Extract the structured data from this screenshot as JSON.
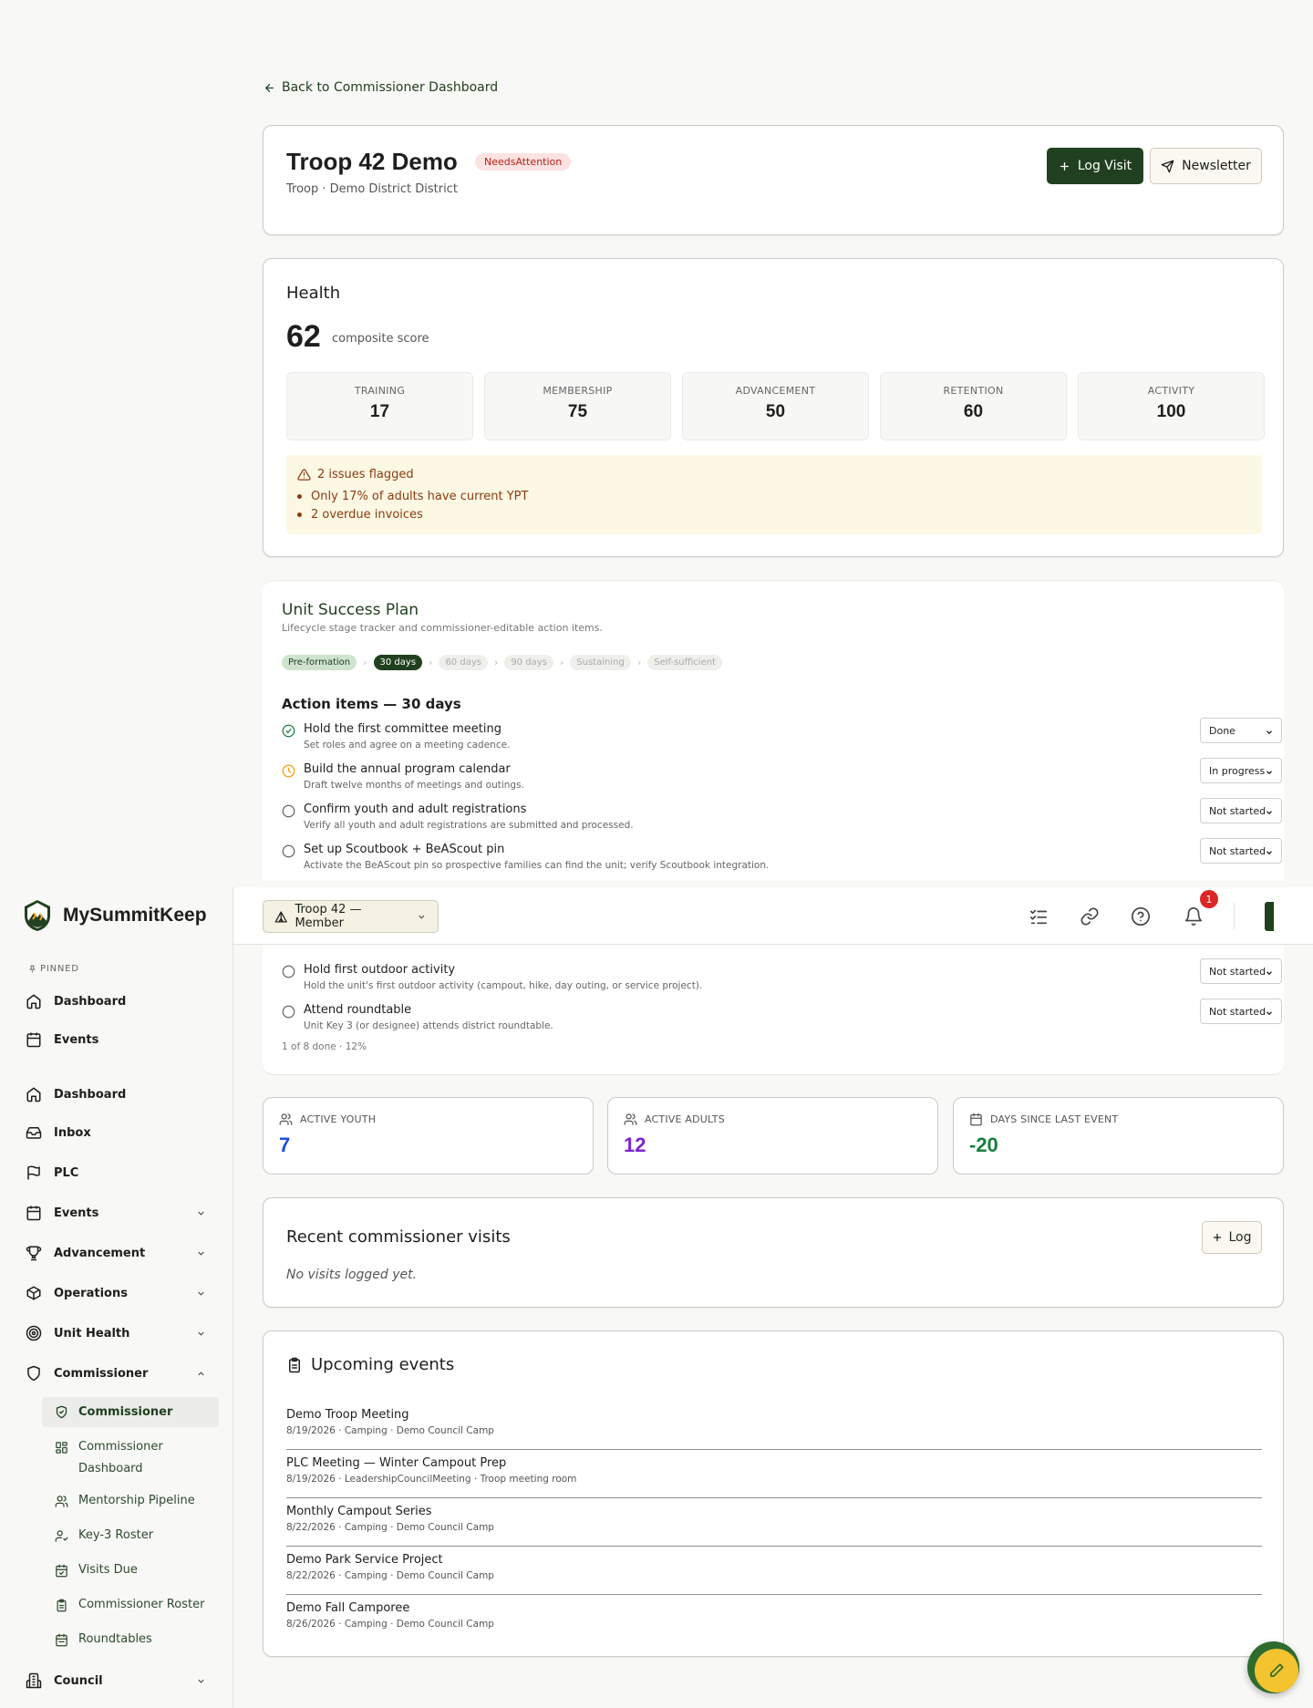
{
  "back_link": "Back to Commissioner Dashboard",
  "unit": {
    "title": "Troop 42 Demo",
    "badge": "NeedsAttention",
    "subtitle": "Troop · Demo District District",
    "log_visit_label": "Log Visit",
    "newsletter_label": "Newsletter"
  },
  "health": {
    "title": "Health",
    "score": "62",
    "score_label": "composite score",
    "metrics": [
      {
        "label": "TRAINING",
        "value": "17"
      },
      {
        "label": "MEMBERSHIP",
        "value": "75"
      },
      {
        "label": "ADVANCEMENT",
        "value": "50"
      },
      {
        "label": "RETENTION",
        "value": "60"
      },
      {
        "label": "ACTIVITY",
        "value": "100"
      }
    ],
    "issues_title": "2 issues flagged",
    "issues": [
      "Only 17% of adults have current YPT",
      "2 overdue invoices"
    ]
  },
  "usp": {
    "title": "Unit Success Plan",
    "subtitle": "Lifecycle stage tracker and commissioner-editable action items.",
    "stages": [
      "Pre-formation",
      "30 days",
      "60 days",
      "90 days",
      "Sustaining",
      "Self-sufficient"
    ],
    "current_stage": "30 days",
    "action_title": "Action items — 30 days",
    "items": [
      {
        "title": "Hold the first committee meeting",
        "desc": "Set roles and agree on a meeting cadence.",
        "status": "Done"
      },
      {
        "title": "Build the annual program calendar",
        "desc": "Draft twelve months of meetings and outings.",
        "status": "In progress"
      },
      {
        "title": "Confirm youth and adult registrations",
        "desc": "Verify all youth and adult registrations are submitted and processed.",
        "status": "Not started"
      },
      {
        "title": "Set up Scoutbook + BeAScout pin",
        "desc": "Activate the BeAScout pin so prospective families can find the unit; verify Scoutbook integration.",
        "status": "Not started"
      },
      {
        "title": "Hold first outdoor activity",
        "desc": "Hold the unit's first outdoor activity (campout, hike, day outing, or service project).",
        "status": "Not started"
      },
      {
        "title": "Attend roundtable",
        "desc": "Unit Key 3 (or designee) attends district roundtable.",
        "status": "Not started"
      }
    ],
    "progress": "1 of 8 done · 12%"
  },
  "stats": [
    {
      "label": "ACTIVE YOUTH",
      "value": "7",
      "color": "#1d4ed8",
      "icon": "users-icon"
    },
    {
      "label": "ACTIVE ADULTS",
      "value": "12",
      "color": "#7e22ce",
      "icon": "users-icon"
    },
    {
      "label": "DAYS SINCE LAST EVENT",
      "value": "-20",
      "color": "#15803d",
      "icon": "calendar-icon"
    }
  ],
  "visits": {
    "title": "Recent commissioner visits",
    "log_label": "Log",
    "empty": "No visits logged yet."
  },
  "events": {
    "title": "Upcoming events",
    "items": [
      {
        "title": "Demo Troop Meeting",
        "meta": "8/19/2026 · Camping · Demo Council Camp"
      },
      {
        "title": "PLC Meeting — Winter Campout Prep",
        "meta": "8/19/2026 · LeadershipCouncilMeeting · Troop meeting room"
      },
      {
        "title": "Monthly Campout Series",
        "meta": "8/22/2026 · Camping · Demo Council Camp"
      },
      {
        "title": "Demo Park Service Project",
        "meta": "8/22/2026 · Camping · Demo Council Camp"
      },
      {
        "title": "Demo Fall Camporee",
        "meta": "8/26/2026 · Camping · Demo Council Camp"
      }
    ]
  },
  "topbar": {
    "unit_selector": "Troop 42 — Member",
    "notification_count": "1"
  },
  "sidebar": {
    "brand": "MySummitKeep",
    "pinned_label": "PINNED",
    "pinned": [
      {
        "label": "Dashboard",
        "icon": "home-icon"
      },
      {
        "label": "Events",
        "icon": "calendar-icon"
      }
    ],
    "nav": [
      {
        "label": "Dashboard",
        "icon": "home-icon"
      },
      {
        "label": "Inbox",
        "icon": "inbox-icon"
      },
      {
        "label": "PLC",
        "icon": "flag-icon"
      },
      {
        "label": "Events",
        "icon": "calendar-icon"
      },
      {
        "label": "Advancement",
        "icon": "trophy-icon"
      },
      {
        "label": "Operations",
        "icon": "package-icon"
      },
      {
        "label": "Unit Health",
        "icon": "target-icon"
      },
      {
        "label": "Commissioner",
        "icon": "shield-icon"
      }
    ],
    "commissioner_sub": [
      {
        "label": "Commissioner",
        "icon": "shield-check-icon"
      },
      {
        "label": "Commissioner Dashboard",
        "icon": "grid-icon"
      },
      {
        "label": "Mentorship Pipeline",
        "icon": "users-icon"
      },
      {
        "label": "Key-3 Roster",
        "icon": "user-check-icon"
      },
      {
        "label": "Visits Due",
        "icon": "calendar-check-icon"
      },
      {
        "label": "Commissioner Roster",
        "icon": "clipboard-icon"
      },
      {
        "label": "Roundtables",
        "icon": "calendar-icon"
      }
    ],
    "council": {
      "label": "Council",
      "icon": "building-icon"
    }
  }
}
